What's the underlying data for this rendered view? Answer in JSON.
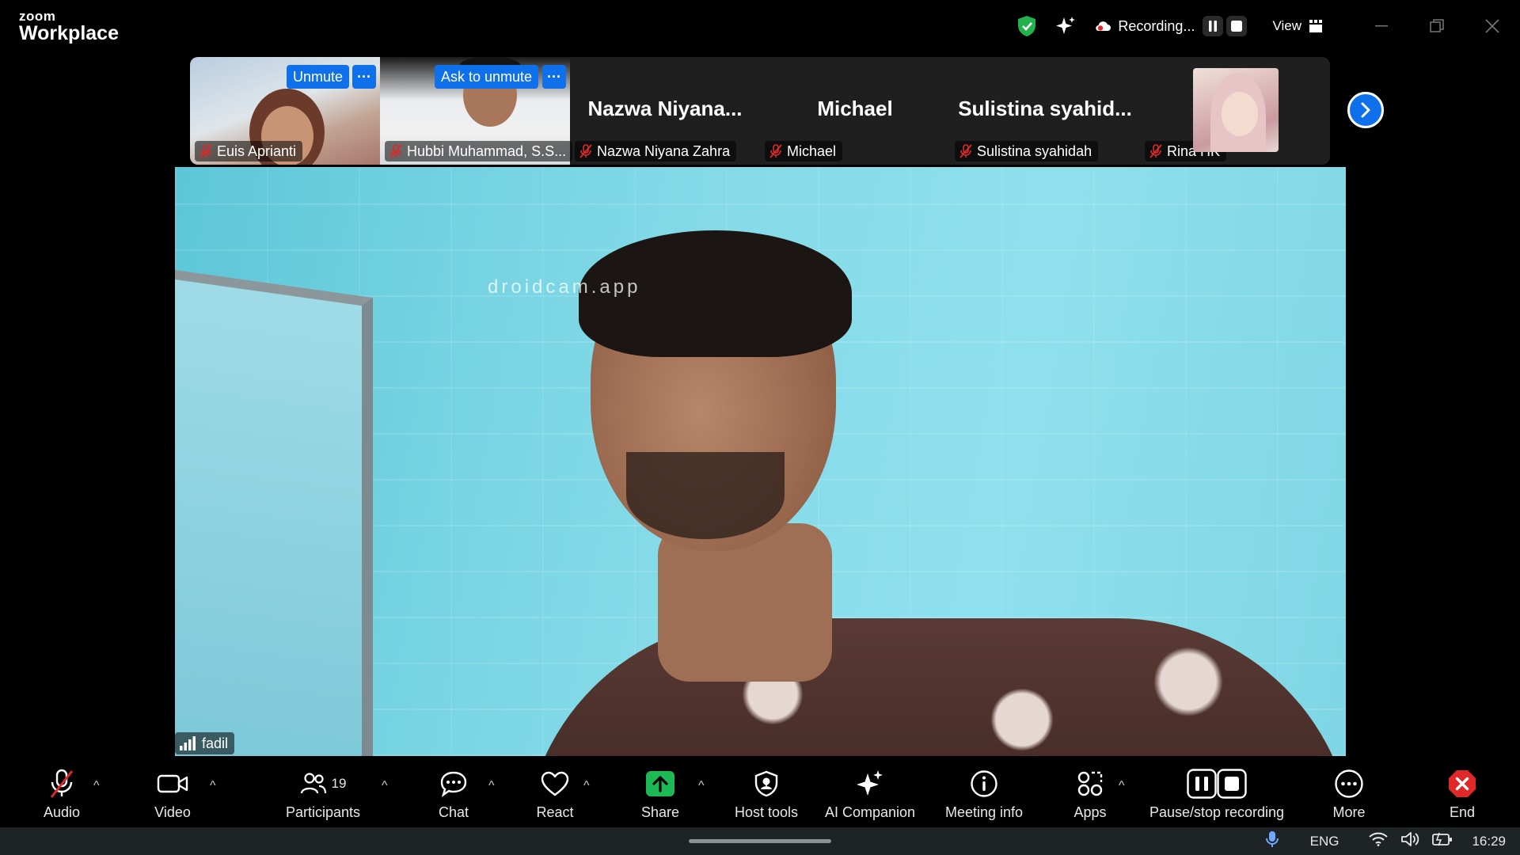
{
  "app": {
    "brand_small": "zoom",
    "brand_large": "Workplace"
  },
  "titlebar": {
    "recording_label": "Recording...",
    "view_label": "View"
  },
  "thumbnails": [
    {
      "name": "Euis Aprianti",
      "has_video": true,
      "action_label": "Unmute",
      "more_label": "···"
    },
    {
      "name": "Hubbi Muhammad, S.S...",
      "has_video": true,
      "action_label": "Ask to unmute",
      "more_label": "···"
    },
    {
      "name": "Nazwa Niyana Zahra",
      "display_name": "Nazwa  Niyana...",
      "has_video": false
    },
    {
      "name": "Michael",
      "display_name": "Michael",
      "has_video": false
    },
    {
      "name": "Sulistina syahidah",
      "display_name": "Sulistina  syahid...",
      "has_video": false
    },
    {
      "name": "Rina HK",
      "has_video": false,
      "has_photo": true
    }
  ],
  "main_video": {
    "speaker_name": "fadil",
    "watermark": "droidcam.app"
  },
  "toolbar": {
    "audio": "Audio",
    "video": "Video",
    "participants": "Participants",
    "participants_count": "19",
    "chat": "Chat",
    "react": "React",
    "share": "Share",
    "host_tools": "Host tools",
    "ai_companion": "AI Companion",
    "meeting_info": "Meeting info",
    "apps": "Apps",
    "pause_stop_recording": "Pause/stop recording",
    "more": "More",
    "end": "End"
  },
  "taskbar": {
    "language": "ENG",
    "time": "16:29"
  },
  "colors": {
    "accent": "#0e71eb",
    "share_green": "#1db954",
    "muted_red": "#e02828",
    "end_red": "#e02828"
  }
}
